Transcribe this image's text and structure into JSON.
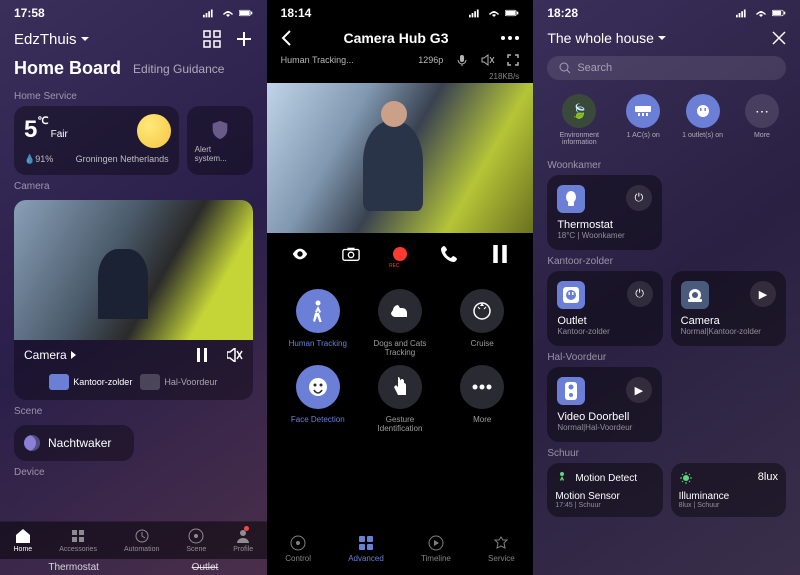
{
  "s1": {
    "time": "17:58",
    "home": "EdzThuis",
    "board": "Home Board",
    "editing": "Editing Guidance",
    "sec_service": "Home Service",
    "weather": {
      "temp": "5",
      "unit": "℃",
      "cond": "Fair",
      "humidity": "91%",
      "loc": "Groningen Netherlands"
    },
    "alert": "Alert system...",
    "sec_camera": "Camera",
    "camera_label": "Camera",
    "sub_cams": [
      "Kantoor-zolder",
      "Hal-Voordeur"
    ],
    "sec_scene": "Scene",
    "scene": "Nachtwaker",
    "sec_device": "Device",
    "tabs": [
      "Home",
      "Accessories",
      "Automation",
      "Scene",
      "Profile"
    ],
    "bottom_devices": [
      "Thermostat",
      "Outlet"
    ]
  },
  "s2": {
    "time": "18:14",
    "title": "Camera Hub G3",
    "tracking": "Human Tracking...",
    "res": "1296p",
    "rate": "218KB/s",
    "features": [
      "Human Tracking",
      "Dogs and Cats Tracking",
      "Cruise",
      "Face Detection",
      "Gesture Identification",
      "More"
    ],
    "tabs": [
      "Control",
      "Advanced",
      "Timeline",
      "Service"
    ]
  },
  "s3": {
    "time": "18:28",
    "title": "The whole house",
    "search": "Search",
    "quicks": [
      {
        "label": "Environment information"
      },
      {
        "label": "1 AC(s) on"
      },
      {
        "label": "1 outlet(s) on"
      },
      {
        "label": "More"
      }
    ],
    "rooms": {
      "woonkamer": {
        "label": "Woonkamer",
        "dev": {
          "name": "Thermostat",
          "sub": "18°C | Woonkamer"
        }
      },
      "kantoor": {
        "label": "Kantoor-zolder",
        "outlet": {
          "name": "Outlet",
          "sub": "Kantoor-zolder"
        },
        "camera": {
          "name": "Camera",
          "sub": "Normal|Kantoor-zolder"
        }
      },
      "hal": {
        "label": "Hal-Voordeur",
        "doorbell": {
          "name": "Video Doorbell",
          "sub": "Normal|Hal-Voordeur"
        }
      },
      "schuur": {
        "label": "Schuur",
        "motion": {
          "title": "Motion Detect",
          "name": "Motion Sensor",
          "sub": "17:45 | Schuur"
        },
        "illum": {
          "val": "8lux",
          "name": "Illuminance",
          "sub": "8lux | Schuur"
        }
      }
    }
  }
}
